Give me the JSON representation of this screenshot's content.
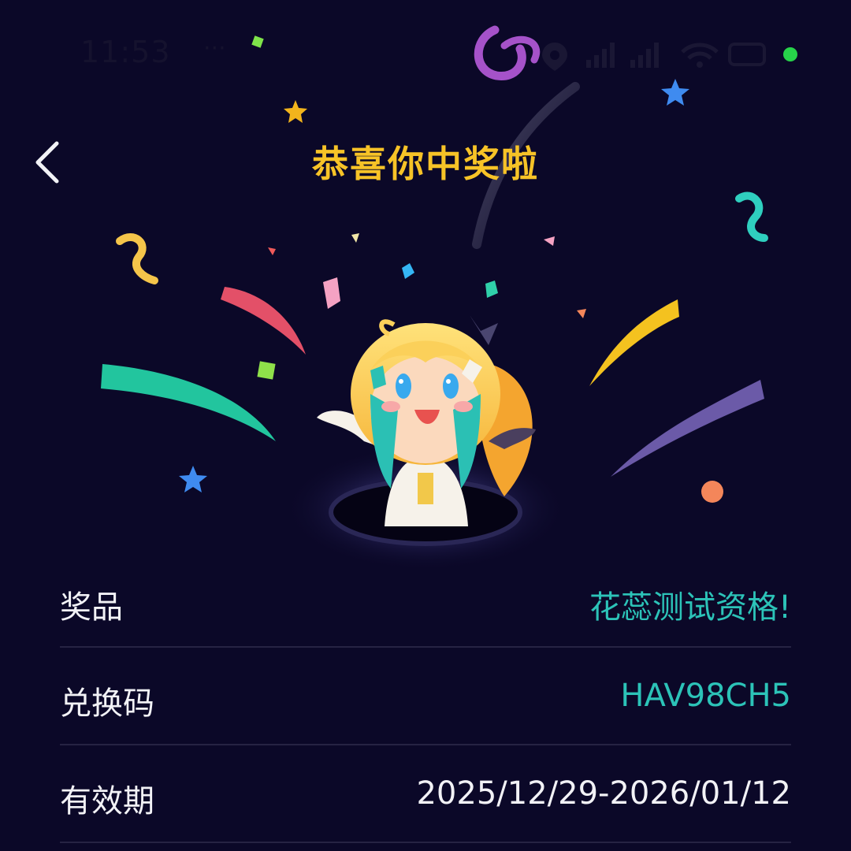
{
  "status_bar": {
    "time": "11:53",
    "more_indicator": "···",
    "icons": [
      "location-icon",
      "signal-icon",
      "signal-icon",
      "wifi-icon",
      "battery-icon"
    ],
    "active_dot_color": "#27d34a"
  },
  "header": {
    "back_icon": "chevron-left-icon",
    "title": "恭喜你中奖啦"
  },
  "colors": {
    "background": "#0b0828",
    "title": "#f7c327",
    "accent_value": "#2cc3b8",
    "divider": "#262343",
    "text": "#f2f2f6"
  },
  "prize_info": {
    "rows": [
      {
        "label": "奖品",
        "value": "花蕊测试资格!"
      },
      {
        "label": "兑换码",
        "value": "HAV98CH5"
      },
      {
        "label": "有效期",
        "value": "2025/12/29-2026/01/12"
      }
    ]
  }
}
